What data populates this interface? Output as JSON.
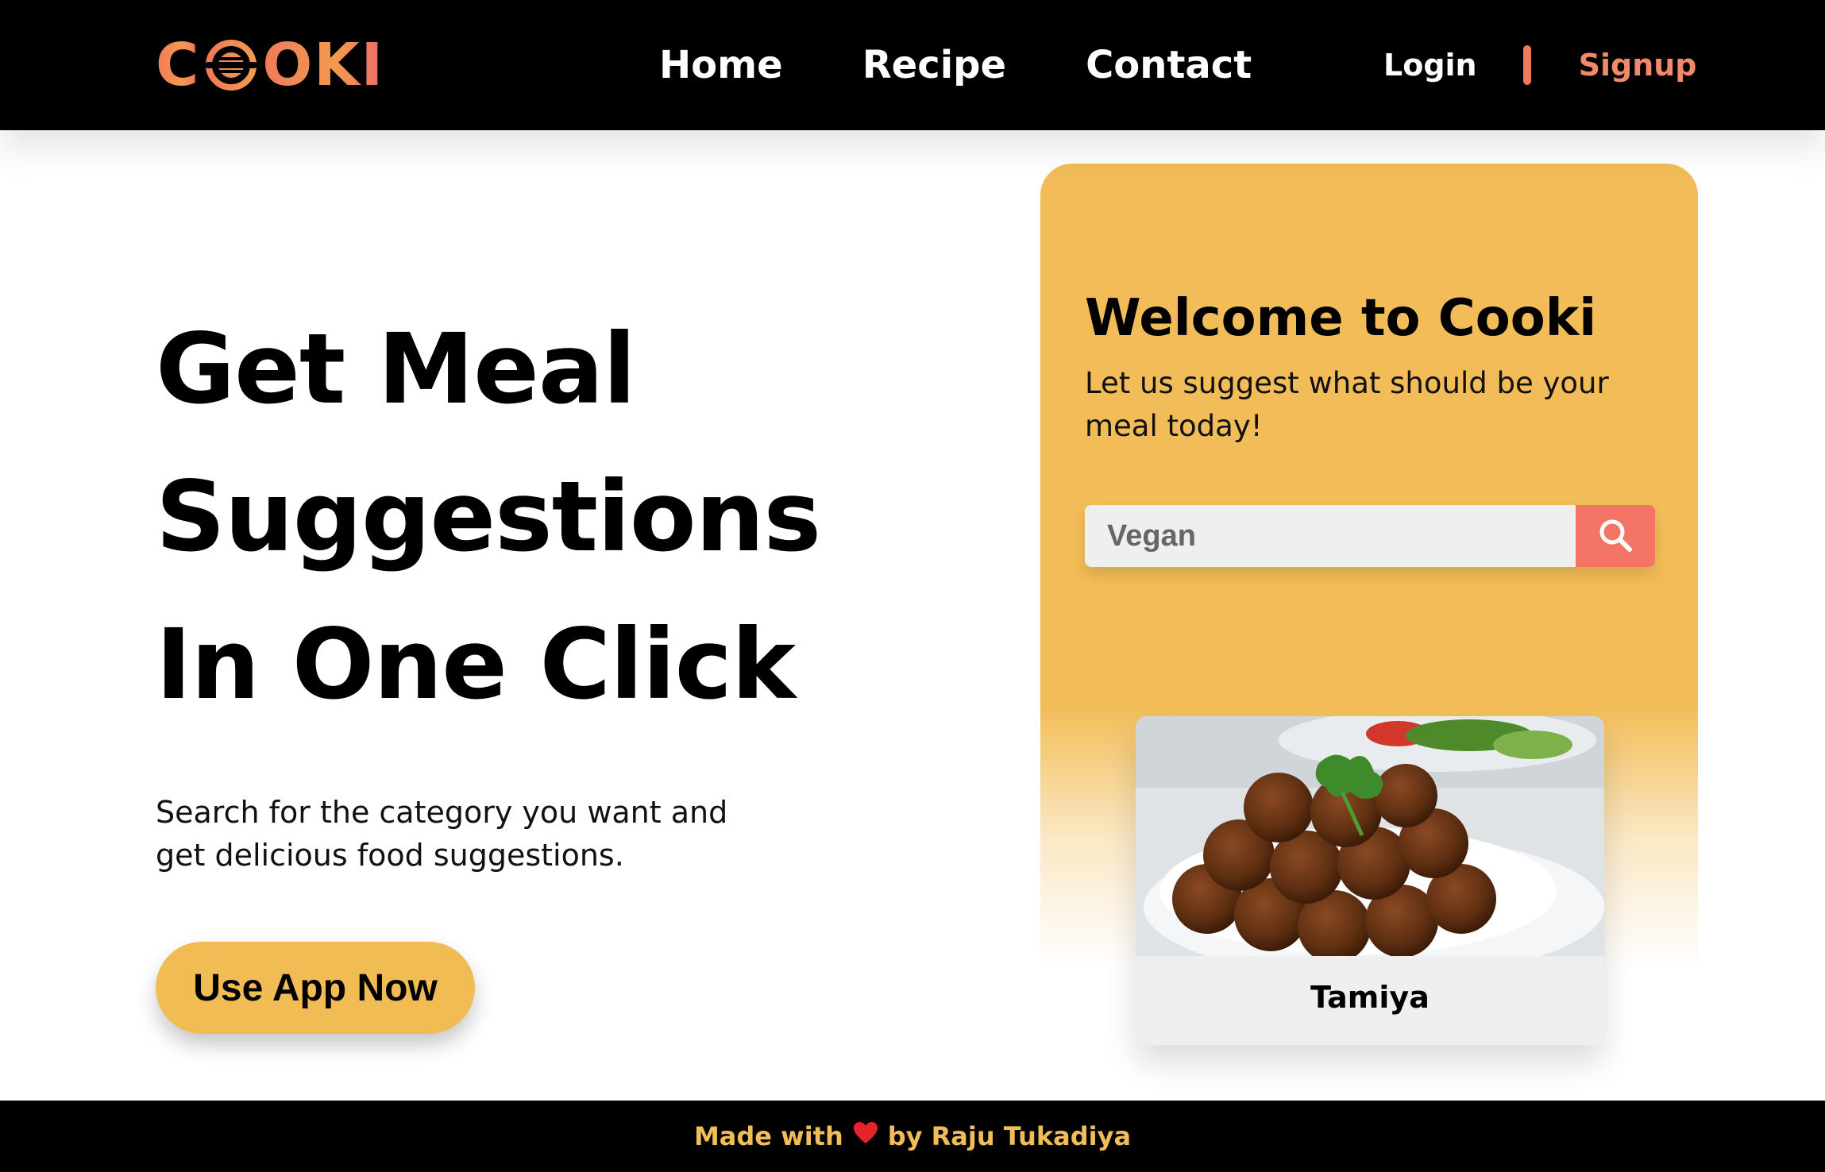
{
  "header": {
    "logo_text_left": "C",
    "logo_text_right": "OKI",
    "logo_full": "COOKI",
    "nav": [
      {
        "label": "Home"
      },
      {
        "label": "Recipe"
      },
      {
        "label": "Contact"
      }
    ],
    "login_label": "Login",
    "signup_label": "Signup"
  },
  "hero": {
    "title_line1": "Get Meal",
    "title_line2": "Suggestions",
    "title_line3": "In One Click",
    "subtitle": "Search for the category you want and get delicious food suggestions.",
    "cta_label": "Use App Now"
  },
  "panel": {
    "title": "Welcome to Cooki",
    "subtitle": "Let us suggest what should be your meal today!",
    "search": {
      "value": "Vegan"
    },
    "meal_card": {
      "name": "Tamiya"
    }
  },
  "footer": {
    "prefix": "Made with",
    "suffix": "by Raju Tukadiya"
  },
  "colors": {
    "accent_yellow": "#f2bd58",
    "accent_coral": "#f47466",
    "header_bg": "#000000"
  }
}
